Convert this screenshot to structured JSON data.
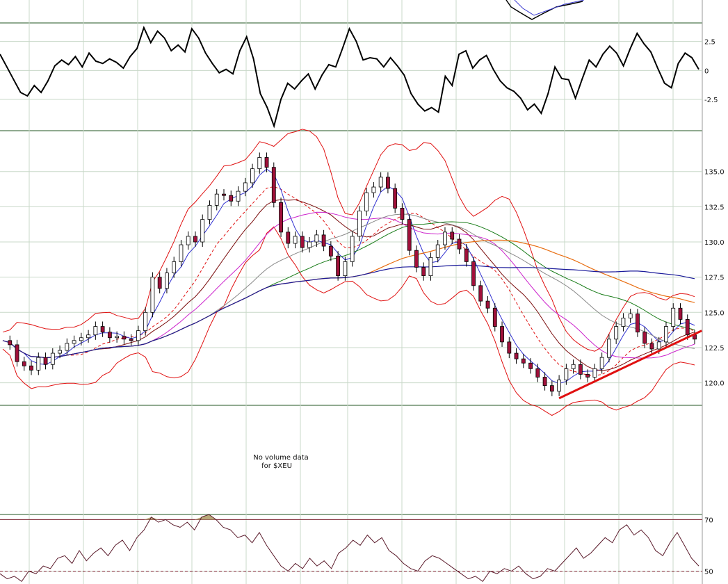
{
  "chart_data": [
    {
      "type": "line",
      "panel": "oscillator",
      "y_ticks": [
        "2.5",
        "0",
        "-2.5"
      ],
      "y_values": [
        2.5,
        0,
        -2.5
      ],
      "ylim": [
        -5.2,
        4.1
      ],
      "grid": true,
      "series": [
        {
          "color": "#000000",
          "values": [
            1.4,
            0.3,
            -0.8,
            -1.9,
            -2.2,
            -1.3,
            -1.9,
            -0.9,
            0.4,
            0.9,
            0.5,
            1.2,
            0.3,
            1.5,
            0.8,
            0.6,
            1.0,
            0.7,
            0.2,
            1.2,
            1.9,
            3.7,
            2.4,
            3.4,
            2.8,
            1.7,
            2.2,
            1.6,
            3.6,
            2.8,
            1.5,
            0.6,
            -0.2,
            0.1,
            -0.3,
            1.7,
            2.9,
            1.0,
            -2.0,
            -3.2,
            -4.8,
            -2.5,
            -1.1,
            -1.6,
            -0.9,
            -0.3,
            -1.6,
            -0.4,
            0.5,
            0.3,
            1.9,
            3.6,
            2.5,
            0.9,
            1.1,
            1.0,
            0.3,
            1.1,
            0.4,
            -0.4,
            -2.0,
            -2.9,
            -3.5,
            -3.2,
            -3.6,
            -0.5,
            -1.3,
            1.4,
            1.7,
            0.2,
            0.9,
            1.3,
            0.1,
            -0.9,
            -1.5,
            -1.8,
            -2.4,
            -3.4,
            -2.9,
            -3.7,
            -2.0,
            0.3,
            -0.7,
            -0.8,
            -2.4,
            -0.7,
            0.9,
            0.3,
            1.4,
            2.1,
            1.5,
            0.4,
            1.9,
            3.2,
            2.3,
            1.6,
            0.2,
            -1.1,
            -1.5,
            0.6,
            1.5,
            1.1,
            0.1
          ]
        }
      ]
    },
    {
      "type": "candlestick",
      "panel": "price",
      "symbol": "$XEU",
      "y_ticks": [
        "135.0",
        "132.5",
        "130.0",
        "127.5",
        "125.0",
        "122.5",
        "120.0"
      ],
      "y_values": [
        135.0,
        132.5,
        130.0,
        127.5,
        125.0,
        122.5,
        120.0
      ],
      "ylim": [
        118.4,
        137.9
      ],
      "grid": true,
      "close_series": [
        123.0,
        122.7,
        121.5,
        121.2,
        120.9,
        121.8,
        121.3,
        122.1,
        122.3,
        122.8,
        123.0,
        123.2,
        123.4,
        124.0,
        123.6,
        123.2,
        123.3,
        123.1,
        123.0,
        123.7,
        125.0,
        127.5,
        126.7,
        127.8,
        128.6,
        129.8,
        130.4,
        130.0,
        131.6,
        132.6,
        133.4,
        133.3,
        132.9,
        133.6,
        134.2,
        135.2,
        136.0,
        135.3,
        132.8,
        130.7,
        129.9,
        130.4,
        129.6,
        130.0,
        130.5,
        129.7,
        129.0,
        127.6,
        128.6,
        130.4,
        132.2,
        133.5,
        133.9,
        134.6,
        133.8,
        132.4,
        131.6,
        129.4,
        128.2,
        127.6,
        128.9,
        129.8,
        130.7,
        130.2,
        129.5,
        128.6,
        126.9,
        125.8,
        125.3,
        124.0,
        122.9,
        122.1,
        121.7,
        121.4,
        121.0,
        120.4,
        119.8,
        119.4,
        120.2,
        121.0,
        121.3,
        120.6,
        120.4,
        121.0,
        121.8,
        123.1,
        124.0,
        124.6,
        124.9,
        123.6,
        122.8,
        122.4,
        122.9,
        124.0,
        125.3,
        124.5,
        123.4,
        123.1
      ],
      "bands": [
        "upper",
        "middle",
        "lower"
      ],
      "moving_averages": [
        "blue",
        "red-dashed",
        "dark-red",
        "magenta",
        "grey",
        "green",
        "orange",
        "navy"
      ],
      "trendline": {
        "from": [
          78,
          118.9
        ],
        "to": [
          98,
          123.7
        ],
        "color": "#e01010"
      }
    },
    {
      "type": "note",
      "panel": "volume",
      "text_line1": "No volume data",
      "text_line2": "for $XEU"
    },
    {
      "type": "line",
      "panel": "rsi",
      "y_ticks": [
        "70",
        "50"
      ],
      "y_values": [
        70,
        50
      ],
      "ylim": [
        45,
        72
      ],
      "grid": true,
      "reference_lines": [
        70,
        50
      ],
      "series": [
        {
          "color": "#5a1a2a",
          "values": [
            49,
            47,
            48,
            46,
            50,
            49,
            52,
            51,
            55,
            56,
            53,
            58,
            54,
            57,
            59,
            56,
            60,
            62,
            58,
            63,
            66,
            71,
            69,
            70,
            68,
            67,
            69,
            66,
            71,
            72,
            70,
            67,
            66,
            63,
            64,
            61,
            65,
            60,
            56,
            52,
            50,
            53,
            51,
            55,
            52,
            54,
            51,
            57,
            59,
            62,
            60,
            64,
            61,
            63,
            58,
            56,
            53,
            51,
            50,
            54,
            56,
            55,
            53,
            51,
            49,
            47,
            48,
            46,
            50,
            49,
            51,
            50,
            52,
            49,
            47,
            48,
            51,
            50,
            53,
            56,
            59,
            55,
            57,
            60,
            63,
            61,
            66,
            68,
            64,
            66,
            63,
            58,
            56,
            61,
            65,
            60,
            55,
            52
          ]
        }
      ]
    }
  ]
}
